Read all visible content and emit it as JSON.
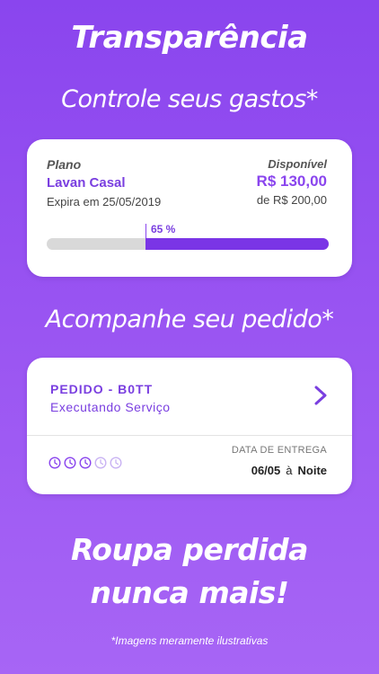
{
  "headings": {
    "title": "Transparência",
    "subtitle1": "Controle seus gastos*",
    "subtitle2": "Acompanhe seu pedido*",
    "big_line1": "Roupa perdida",
    "big_line2": "nunca mais!",
    "disclaimer": "*Imagens meramente ilustrativas"
  },
  "plan_card": {
    "label": "Plano",
    "name": "Lavan Casal",
    "expiry": "Expira em 25/05/2019",
    "available_label": "Disponível",
    "available_amount": "R$ 130,00",
    "available_total": "de R$ 200,00",
    "progress_percent": 65,
    "progress_label": "65 %"
  },
  "order_card": {
    "title": "PEDIDO - B0TT",
    "status": "Executando Serviço",
    "clock_steps_total": 5,
    "clock_steps_done": 3,
    "delivery_label": "DATA DE ENTREGA",
    "delivery_date": "06/05",
    "delivery_sep": "à",
    "delivery_period": "Noite"
  },
  "colors": {
    "accent": "#8a45ee",
    "accent_dark": "#7a35e6",
    "track": "#d9d9d9"
  },
  "icons": {
    "chevron": "chevron-right-icon",
    "clock": "clock-icon"
  }
}
